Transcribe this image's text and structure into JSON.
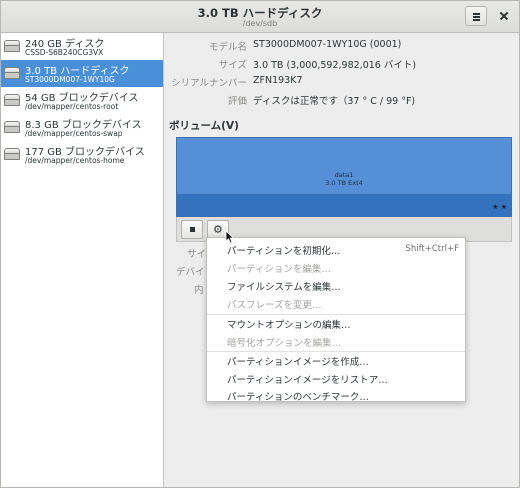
{
  "window": {
    "title": "3.0 TB ハードディスク",
    "subtitle": "/dev/sdb"
  },
  "sidebar": {
    "items": [
      {
        "name": "240 GB ディスク",
        "path": "CSSD-S6B240CG3VX",
        "selected": false
      },
      {
        "name": "3.0 TB ハードディスク",
        "path": "ST3000DM007-1WY10G",
        "selected": true
      },
      {
        "name": "54 GB ブロックデバイス",
        "path": "/dev/mapper/centos-root",
        "selected": false
      },
      {
        "name": "8.3 GB ブロックデバイス",
        "path": "/dev/mapper/centos-swap",
        "selected": false
      },
      {
        "name": "177 GB ブロックデバイス",
        "path": "/dev/mapper/centos-home",
        "selected": false
      }
    ]
  },
  "details": {
    "model_label": "モデル名",
    "model_value": "ST3000DM007-1WY10G (0001)",
    "size_label": "サイズ",
    "size_value": "3.0 TB (3,000,592,982,016 バイト)",
    "serial_label": "シリアルナンバー",
    "serial_value": "ZFN193K7",
    "assessment_label": "評価",
    "assessment_value": "ディスクは正常です（37 ° C / 99 °F)"
  },
  "volumes": {
    "heading": "ボリューム(V)",
    "partition_name": "data1",
    "partition_type": "3.0 TB Ext4",
    "partition_icons": "★ ★",
    "hidden_label_size": "サイ",
    "hidden_label_device": "デバイ",
    "hidden_label_contents": "内"
  },
  "context_menu": {
    "items": [
      {
        "label": "パーティションを初期化…",
        "shortcut": "Shift+Ctrl+F",
        "enabled": true
      },
      {
        "label": "パーティションを編集…",
        "shortcut": "",
        "enabled": false
      },
      {
        "label": "ファイルシステムを編集…",
        "shortcut": "",
        "enabled": true
      },
      {
        "label": "パスフレーズを変更…",
        "shortcut": "",
        "enabled": false
      },
      {
        "label": "マウントオプションの編集…",
        "shortcut": "",
        "enabled": true
      },
      {
        "label": "暗号化オプションを編集…",
        "shortcut": "",
        "enabled": false
      },
      {
        "label": "パーティションイメージを作成…",
        "shortcut": "",
        "enabled": true
      },
      {
        "label": "パーティションイメージをリストア…",
        "shortcut": "",
        "enabled": true
      },
      {
        "label": "パーティションのベンチマーク…",
        "shortcut": "",
        "enabled": true
      }
    ]
  },
  "colors": {
    "selection": "#4a90d9",
    "partition_fill": "#5590d6",
    "partition_lower": "#3572be"
  }
}
